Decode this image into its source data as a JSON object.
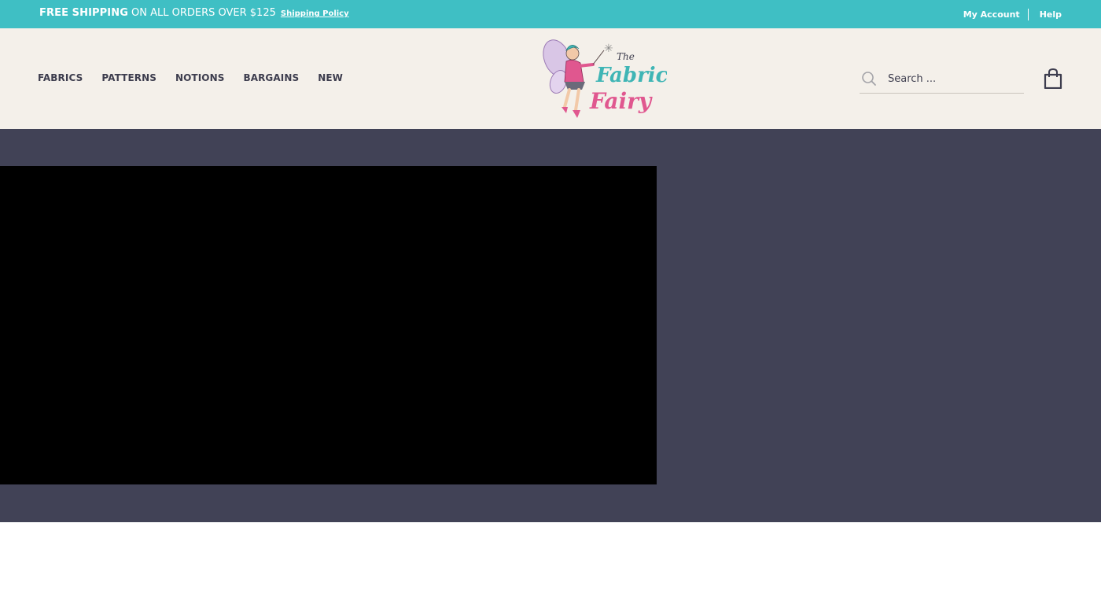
{
  "topbar": {
    "promo_strong": "FREE SHIPPING",
    "promo_rest": "ON ALL ORDERS OVER $125",
    "promo_link": "Shipping Policy",
    "my_account": "My Account",
    "help": "Help",
    "background_color": "#3fbfc4"
  },
  "nav": {
    "items": [
      {
        "label": "FABRICS"
      },
      {
        "label": "PATTERNS"
      },
      {
        "label": "NOTIONS"
      },
      {
        "label": "BARGAINS"
      },
      {
        "label": "NEW"
      }
    ]
  },
  "logo": {
    "line1": "The",
    "line2": "Fabric",
    "line3": "Fairy"
  },
  "search": {
    "placeholder": "Search ..."
  },
  "colors": {
    "header_bg": "#f4f0ea",
    "hero_bg": "#414256",
    "video_bg": "#000000",
    "logo_pink": "#e0578f",
    "logo_teal": "#3fb5b5"
  },
  "icons": {
    "search": "search-icon",
    "cart": "shopping-bag-icon"
  }
}
